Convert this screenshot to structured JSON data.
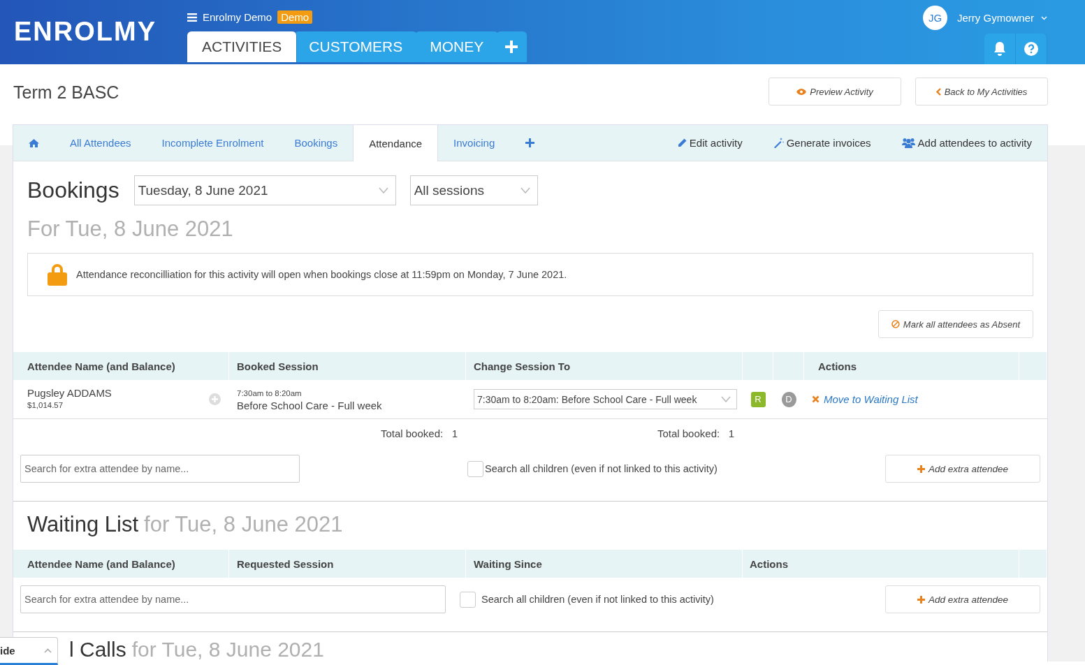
{
  "header": {
    "logo": "ENROLMY",
    "account": "Enrolmy Demo",
    "badge": "Demo",
    "nav": [
      {
        "label": "ACTIVITIES",
        "selected": true
      },
      {
        "label": "CUSTOMERS",
        "selected": false
      },
      {
        "label": "MONEY",
        "selected": false
      }
    ],
    "user": {
      "initials": "JG",
      "name": "Jerry Gymowner"
    }
  },
  "page": {
    "title": "Term 2 BASC",
    "buttons": [
      "Preview Activity",
      "Back to My Activities"
    ]
  },
  "tabs": [
    {
      "kind": "home",
      "selected": false
    },
    {
      "kind": "text",
      "label": "All Attendees",
      "selected": false
    },
    {
      "kind": "text",
      "label": "Incomplete Enrolment",
      "selected": false
    },
    {
      "kind": "text",
      "label": "Bookings",
      "selected": false
    },
    {
      "kind": "text",
      "label": "Attendance",
      "selected": true
    },
    {
      "kind": "text",
      "label": "Invoicing",
      "selected": false
    },
    {
      "kind": "add",
      "selected": false
    }
  ],
  "tab_actions": [
    "Edit activity",
    "Generate invoices",
    "Add attendees to activity"
  ],
  "bookings": {
    "heading": "Bookings",
    "date": "Tuesday, 8 June 2021",
    "session": "All sessions",
    "subheading": "For Tue, 8 June 2021",
    "notice": "Attendance reconcilliation for this activity will open when bookings close at 11:59pm on Monday, 7 June 2021.",
    "mark_absent": "Mark all attendees as Absent",
    "columns": [
      "Attendee Name (and Balance)",
      "Booked Session",
      "Change Session To",
      "Actions"
    ],
    "rows": [
      {
        "name": "Pugsley ADDAMS",
        "balance": "$1,014.57",
        "time": "7:30am to 8:20am",
        "session": "Before School Care - Full week",
        "change_to": "7:30am to 8:20am: Before School Care - Full week",
        "flags": [
          {
            "label": "R",
            "on": true
          },
          {
            "label": "D",
            "on": false
          }
        ],
        "action": "Move to Waiting List"
      }
    ],
    "totals": [
      {
        "label": "Total booked:",
        "value": "1"
      },
      {
        "label": "Total booked:",
        "value": "1"
      }
    ],
    "search_placeholder": "Search for extra attendee by name...",
    "search_all": {
      "label": "Search all children (even if not linked to this activity)",
      "checked": false
    },
    "add_button": "Add extra attendee"
  },
  "waiting_list": {
    "title": "Waiting List",
    "subtitle": "for Tue, 8 June 2021",
    "columns": [
      "Attendee Name (and Balance)",
      "Requested Session",
      "Waiting Since",
      "Actions"
    ],
    "search_placeholder": "Search for extra attendee by name...",
    "search_all": {
      "label": "Search all children (even if not linked to this activity)",
      "checked": false
    },
    "add_button": "Add extra attendee"
  },
  "roll_calls": {
    "title": "l Calls",
    "subtitle": "for Tue, 8 June 2021"
  },
  "guide": {
    "label": "ide"
  }
}
